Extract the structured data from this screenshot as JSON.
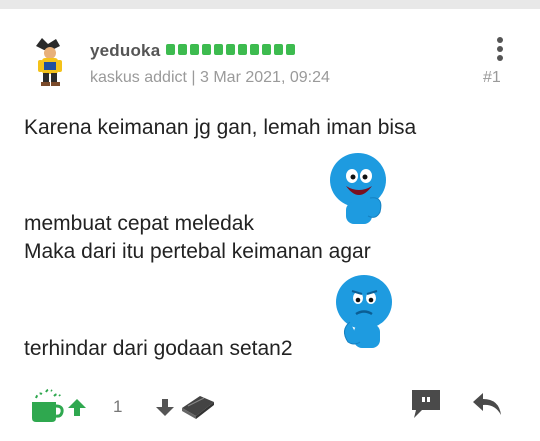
{
  "post": {
    "username": "yeduoka",
    "rank": "kaskus addict",
    "date": "3 Mar 2021, 09:24",
    "separator": "|",
    "post_number": "#1",
    "reputation_dots": 11,
    "lines": [
      "Karena keimanan jg gan, lemah iman bisa",
      "membuat cepat meledak",
      "Maka dari itu pertebal keimanan agar",
      "terhindar dari godaan setan2"
    ],
    "emoticons": [
      "blue-happy-emoticon",
      "blue-sad-emoticon"
    ]
  },
  "actions": {
    "upvote_count": "1",
    "icons": [
      "cendol-icon",
      "upvote-icon",
      "downvote-icon",
      "bata-icon",
      "comment-icon",
      "reply-icon"
    ],
    "accent": "#2fa84f"
  }
}
